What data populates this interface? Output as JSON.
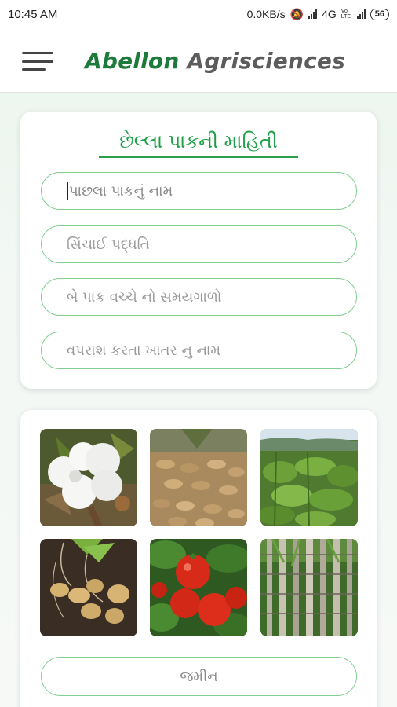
{
  "status_bar": {
    "time": "10:45 AM",
    "speed": "0.0KB/s",
    "network": "4G",
    "volte": "Vo LTE",
    "battery": "56"
  },
  "app_bar": {
    "menu_icon": "hamburger-menu-icon",
    "brand_part1": "Abellon",
    "brand_part2": "Agrisciences",
    "brand_color": "#1e7a3a"
  },
  "previous_crop_card": {
    "title": "છેલ્લા પાકની માહિતી",
    "fields": [
      {
        "placeholder": "પાછલા પાકનું નામ",
        "value": ""
      },
      {
        "placeholder": "સિંચાઈ પદ્ધતિ",
        "value": ""
      },
      {
        "placeholder": "બે પાક વચ્ચે નો સમયગાળો",
        "value": ""
      },
      {
        "placeholder": "વપરાશ કરતા ખાતર નુ નામ",
        "value": ""
      }
    ]
  },
  "crops_card": {
    "crop_images": [
      "cotton",
      "groundnut",
      "tobacco",
      "potato",
      "tomato",
      "sugarcane"
    ],
    "land_field": "જમીન"
  },
  "colors": {
    "accent": "#1ea046",
    "field_border": "#7fcf8e"
  }
}
